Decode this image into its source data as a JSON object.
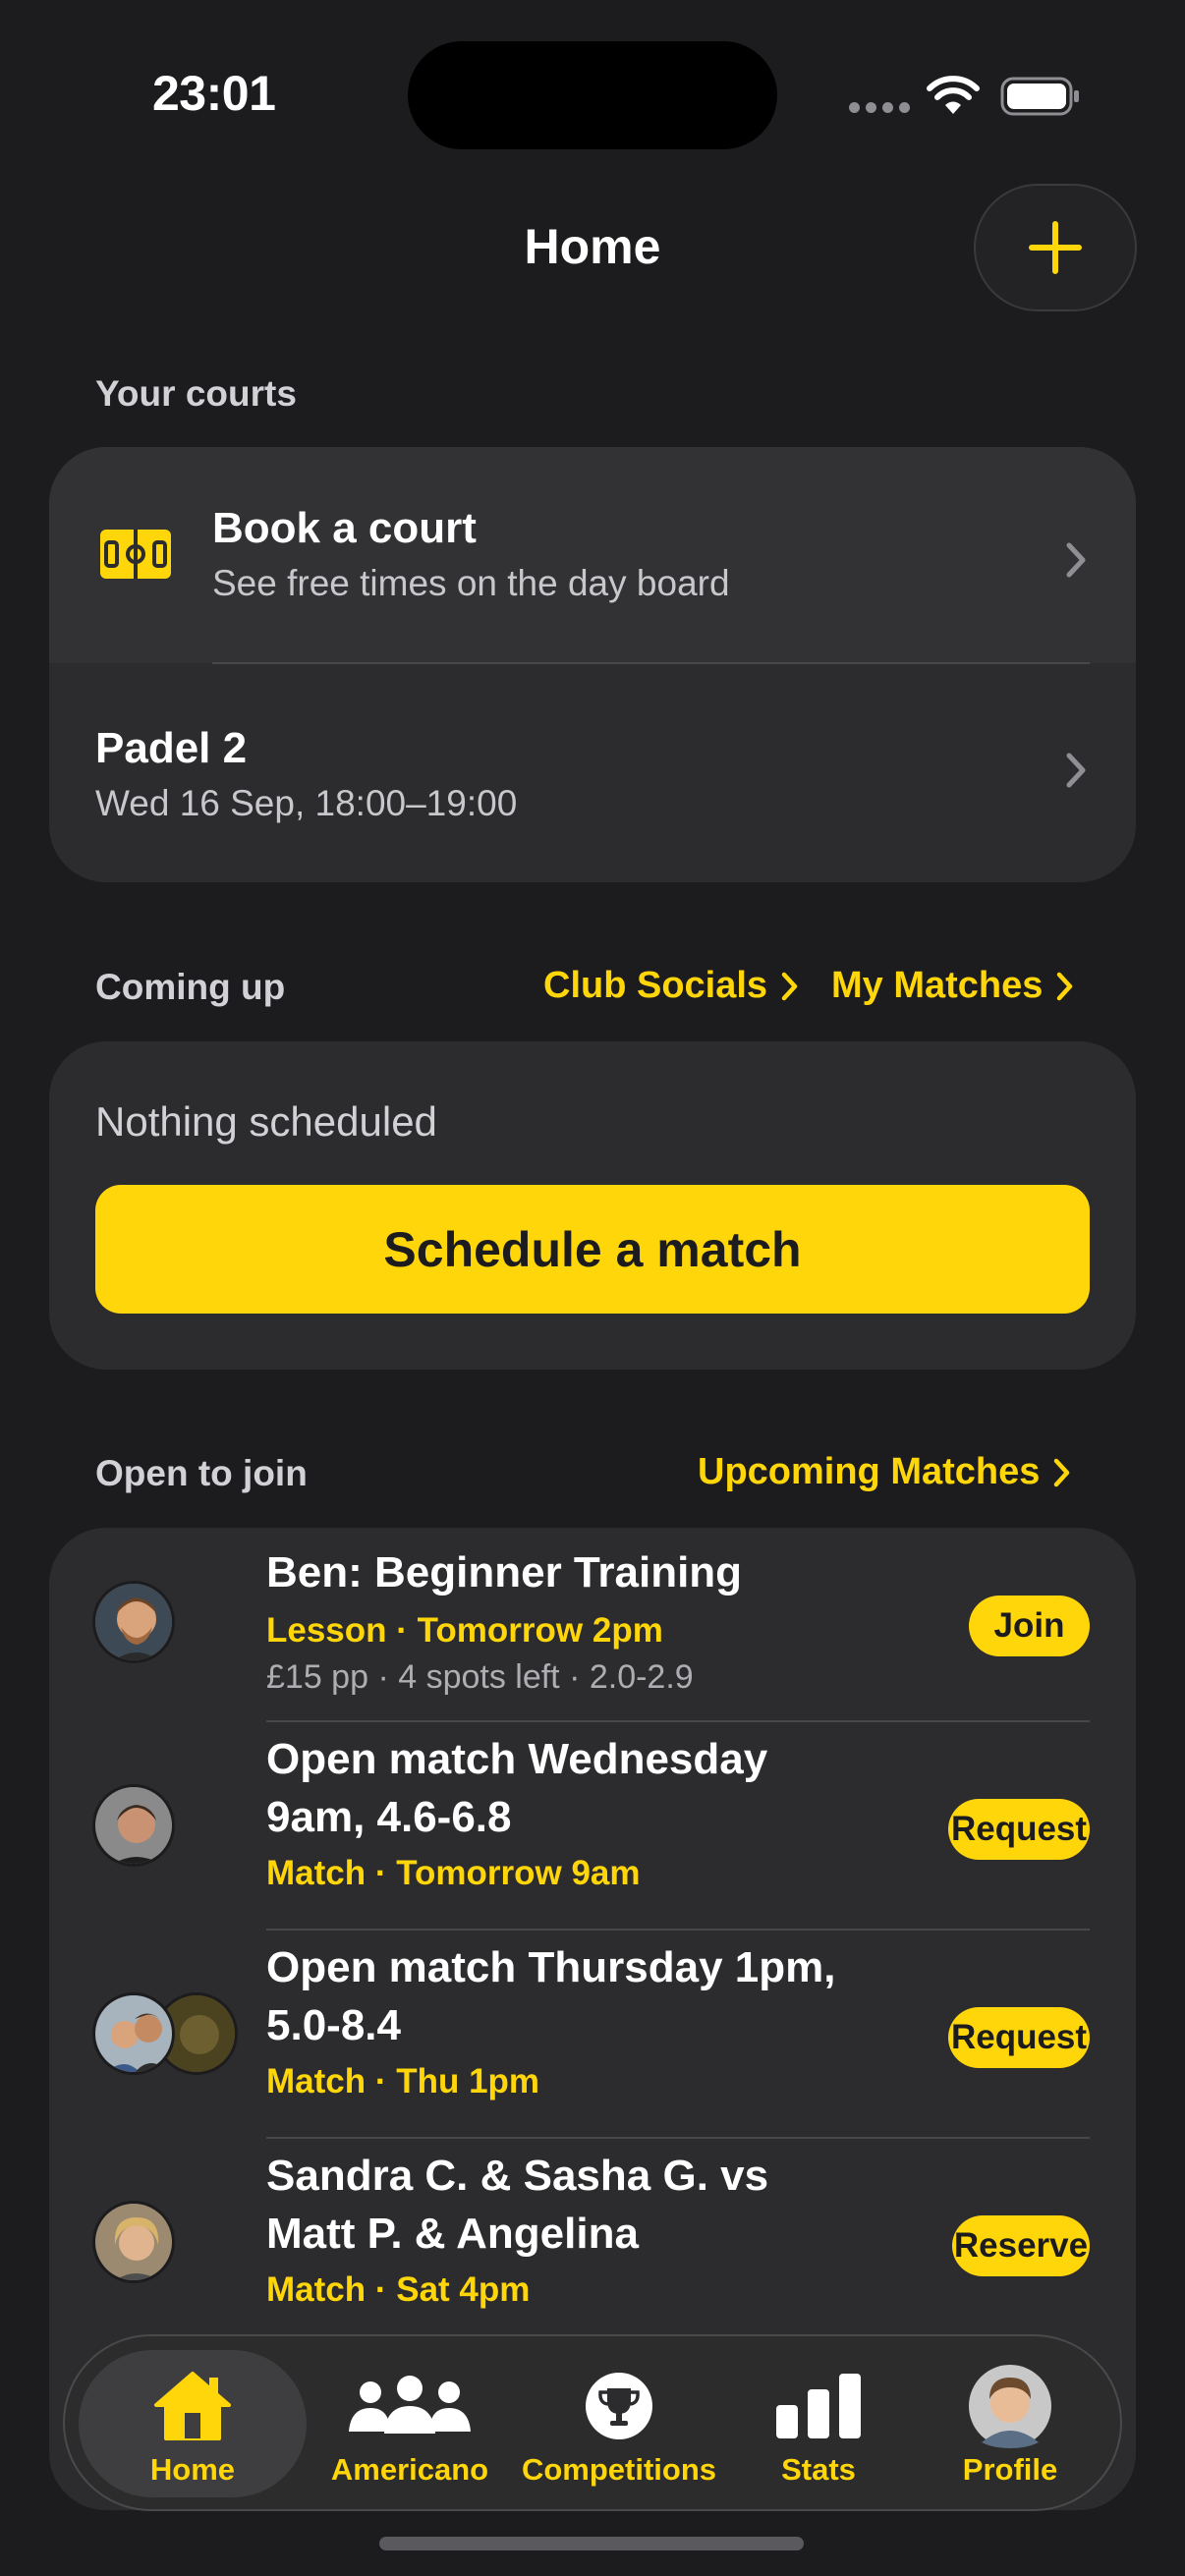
{
  "status_bar": {
    "time": "23:01"
  },
  "header": {
    "title": "Home",
    "add_icon": "plus-icon"
  },
  "courts": {
    "section_label": "Your courts",
    "book": {
      "title": "Book a court",
      "subtitle": "See free times on the day board",
      "icon": "court-icon"
    },
    "booking": {
      "title": "Padel 2",
      "subtitle": "Wed 16 Sep, 18:00–19:00"
    }
  },
  "coming_up": {
    "section_label": "Coming up",
    "link_socials": "Club Socials",
    "link_matches": "My Matches",
    "empty_text": "Nothing scheduled",
    "schedule_button": "Schedule a match"
  },
  "open_to_join": {
    "section_label": "Open to join",
    "link_upcoming": "Upcoming Matches",
    "items": [
      {
        "title": "Ben: Beginner Training",
        "meta": "Lesson · Tomorrow 2pm",
        "extra": "£15 pp · 4 spots left · 2.0-2.9",
        "action": "Join"
      },
      {
        "title_line1": "Open match Wednesday",
        "title_line2": "9am, 4.6-6.8",
        "meta": "Match · Tomorrow 9am",
        "action": "Request"
      },
      {
        "title_line1": "Open match Thursday 1pm,",
        "title_line2": "5.0-8.4",
        "meta": "Match · Thu 1pm",
        "action": "Request"
      },
      {
        "title_line1": "Sandra C. & Sasha G. vs",
        "title_line2": "Matt P. & Angelina",
        "meta": "Match · Sat 4pm",
        "action": "Reserve"
      }
    ]
  },
  "tabbar": {
    "active": "Home",
    "tabs": [
      {
        "label": "Home",
        "icon": "house-icon"
      },
      {
        "label": "Americano",
        "icon": "people-icon"
      },
      {
        "label": "Competitions",
        "icon": "trophy-icon"
      },
      {
        "label": "Stats",
        "icon": "bar-chart-icon"
      },
      {
        "label": "Profile",
        "icon": "avatar"
      }
    ]
  },
  "colors": {
    "accent": "#ffd60a",
    "background": "#1c1c1e",
    "card": "#2c2c2e"
  }
}
